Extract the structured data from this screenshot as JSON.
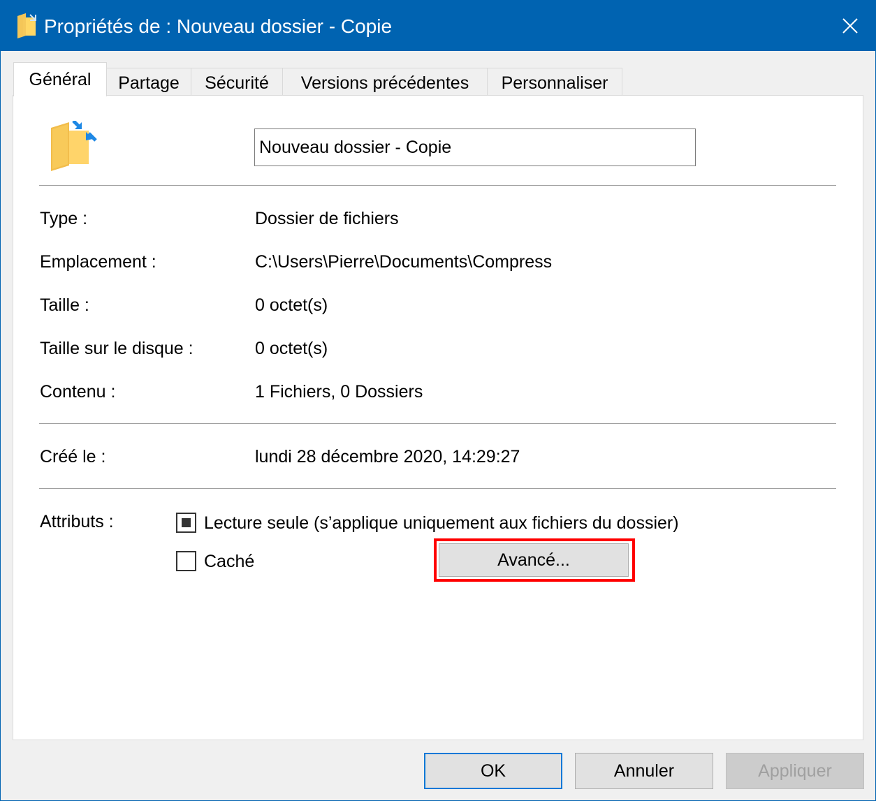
{
  "window": {
    "title": "Propriétés de : Nouveau dossier - Copie",
    "accent_color": "#0063b1",
    "close_icon": "close-icon"
  },
  "tabs": [
    {
      "label": "Général",
      "active": true
    },
    {
      "label": "Partage",
      "active": false
    },
    {
      "label": "Sécurité",
      "active": false
    },
    {
      "label": "Versions précédentes",
      "active": false
    },
    {
      "label": "Personnaliser",
      "active": false
    }
  ],
  "general": {
    "folder_icon": "folder-shortcut-icon",
    "name_value": "Nouveau dossier - Copie",
    "info": [
      {
        "label": "Type :",
        "value": "Dossier de fichiers"
      },
      {
        "label": "Emplacement :",
        "value": "C:\\Users\\Pierre\\Documents\\Compress"
      },
      {
        "label": "Taille :",
        "value": "0 octet(s)"
      },
      {
        "label": "Taille sur le disque :",
        "value": "0 octet(s)"
      },
      {
        "label": "Contenu :",
        "value": "1 Fichiers, 0 Dossiers"
      }
    ],
    "created": {
      "label": "Créé le :",
      "value": "lundi 28 décembre 2020, 14:29:27"
    },
    "attributes": {
      "label": "Attributs :",
      "readonly": {
        "label": "Lecture seule (s’applique uniquement aux fichiers du dossier)",
        "state": "indeterminate"
      },
      "hidden": {
        "label": "Caché",
        "state": "unchecked"
      },
      "advanced_label": "Avancé..."
    },
    "highlight_color": "#ff0000"
  },
  "buttons": {
    "ok": "OK",
    "cancel": "Annuler",
    "apply": "Appliquer"
  }
}
